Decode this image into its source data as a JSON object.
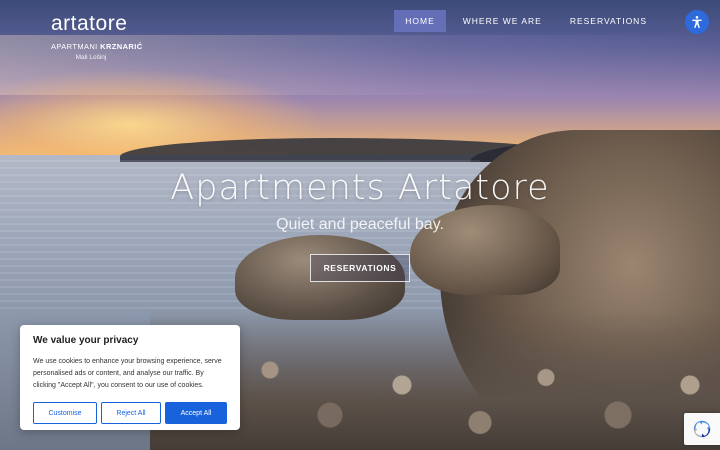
{
  "brand": {
    "logo": "artatore",
    "subtitle_prefix": "APARTMANI",
    "subtitle_name": "KRZNARIĆ",
    "location": "Mali Lošinj"
  },
  "nav": {
    "items": [
      {
        "label": "HOME",
        "active": true
      },
      {
        "label": "WHERE WE ARE",
        "active": false
      },
      {
        "label": "RESERVATIONS",
        "active": false
      }
    ]
  },
  "accessibility": {
    "icon": "accessibility-icon",
    "color": "#2d6bdc"
  },
  "hero": {
    "title": "Apartments Artatore",
    "tagline": "Quiet and peaceful bay.",
    "button_label": "RESERVATIONS"
  },
  "cookie_banner": {
    "title": "We value your privacy",
    "text": "We use cookies to enhance your browsing experience, serve personalised ads or content, and analyse our traffic. By clicking \"Accept All\", you consent to our use of cookies.",
    "buttons": {
      "customise": "Customise",
      "reject": "Reject All",
      "accept": "Accept All"
    },
    "accent_color": "#1863dc"
  },
  "recaptcha": {
    "icon": "recaptcha-icon"
  }
}
